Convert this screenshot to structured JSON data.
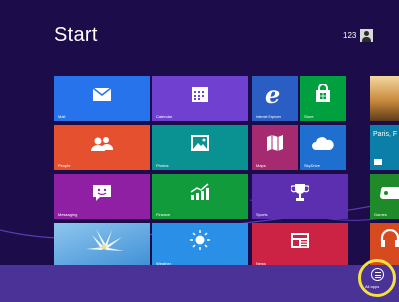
{
  "screen": {
    "title": "Start",
    "user_name": "123"
  },
  "tiles": {
    "mail": {
      "label": "Mail",
      "color": "#2673ec"
    },
    "calendar": {
      "label": "Calendar",
      "color": "#7040d0"
    },
    "ie": {
      "label": "Internet Explorer",
      "color": "#2b5ec4"
    },
    "store": {
      "label": "Store",
      "color": "#00a03e"
    },
    "people": {
      "label": "People",
      "color": "#e5512e"
    },
    "photos": {
      "label": "Photos",
      "color": "#0a9191"
    },
    "maps": {
      "label": "Maps",
      "color": "#a52a70"
    },
    "skydrive": {
      "label": "SkyDrive",
      "color": "#1f6fd1"
    },
    "messaging": {
      "label": "Messaging",
      "color": "#8f1fa3"
    },
    "finance": {
      "label": "Finance",
      "color": "#119b3a"
    },
    "sports": {
      "label": "Sports",
      "color": "#5b2fb0"
    },
    "weather": {
      "label": "Weather",
      "color": "#2a8fe6"
    },
    "news": {
      "label": "News",
      "color": "#cc2244"
    },
    "travel": {
      "label": "Paris, F",
      "color": "#0b7fa8"
    },
    "games": {
      "label": "Games",
      "color": "#1f8a2a"
    },
    "music": {
      "label": "Music",
      "color": "#d74a1f"
    }
  },
  "app_bar": {
    "all_apps_label": "All apps",
    "highlight_color": "#f3e23d"
  }
}
